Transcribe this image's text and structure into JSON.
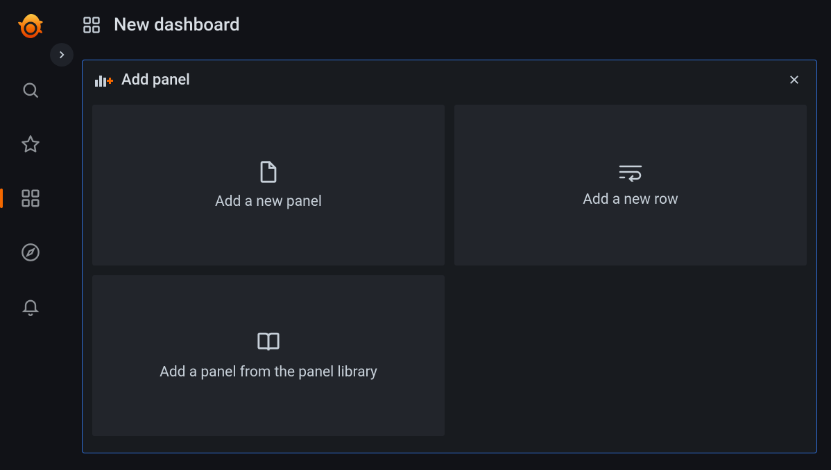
{
  "header": {
    "title": "New dashboard"
  },
  "panel_editor": {
    "title": "Add panel",
    "cards": [
      {
        "id": "add-new-panel",
        "label": "Add a new panel"
      },
      {
        "id": "add-new-row",
        "label": "Add a new row"
      },
      {
        "id": "add-from-library",
        "label": "Add a panel from the panel library"
      }
    ]
  },
  "sidebar": {
    "items": [
      {
        "id": "search",
        "icon": "search-icon"
      },
      {
        "id": "starred",
        "icon": "star-icon"
      },
      {
        "id": "dashboards",
        "icon": "dashboards-icon",
        "active": true
      },
      {
        "id": "explore",
        "icon": "compass-icon"
      },
      {
        "id": "alerting",
        "icon": "bell-icon"
      }
    ]
  }
}
